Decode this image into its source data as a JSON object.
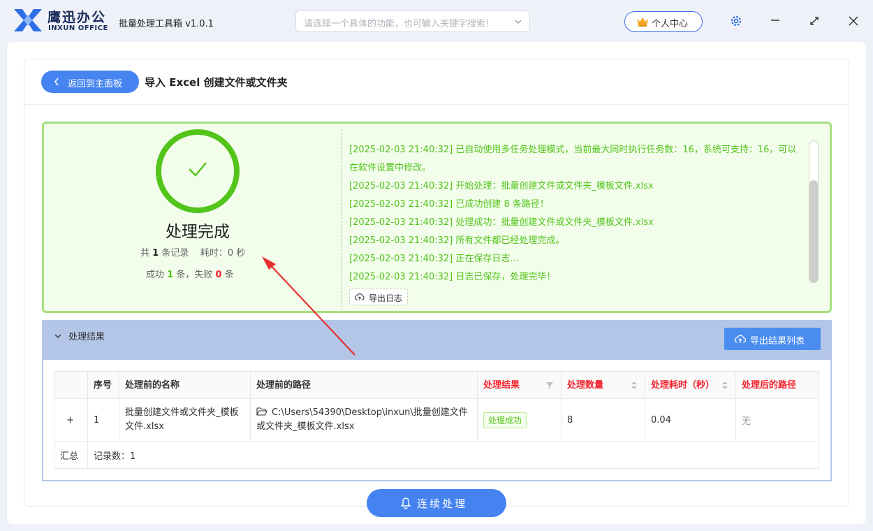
{
  "titlebar": {
    "brand_cn": "鹰迅办公",
    "brand_en": "INXUN OFFICE",
    "app_title": "批量处理工具箱 v1.0.1",
    "search_placeholder": "请选择一个具体的功能，也可输入关键字搜索！",
    "user_center": "个人中心"
  },
  "header": {
    "back_label": "返回到主面板",
    "page_title": "导入 Excel 创建文件或文件夹"
  },
  "summary": {
    "status_title": "处理完成",
    "total_prefix": "共",
    "total_count": "1",
    "total_suffix": "条记录",
    "time_label": "耗时：0 秒",
    "success_prefix": "成功",
    "success_count": "1",
    "fail_prefix": "条，失败",
    "fail_count": "0",
    "fail_suffix": "条"
  },
  "log": {
    "lines": [
      "[2025-02-03 21:40:32] 已自动使用多任务处理模式，当前最大同时执行任务数：16，系统可支持：16，可以在软件设置中修改。",
      "[2025-02-03 21:40:32] 开始处理：批量创建文件或文件夹_模板文件.xlsx",
      "[2025-02-03 21:40:32] 已成功创建 8 条路径！",
      "[2025-02-03 21:40:32] 处理成功：批量创建文件或文件夹_模板文件.xlsx",
      "[2025-02-03 21:40:32] 所有文件都已经处理完成。",
      "[2025-02-03 21:40:32] 正在保存日志...",
      "[2025-02-03 21:40:32] 日志已保存，处理完毕！"
    ],
    "export_label": "导出日志"
  },
  "results": {
    "section_title": "处理结果",
    "export_label": "导出结果列表",
    "columns": [
      "",
      "序号",
      "处理前的名称",
      "处理前的路径",
      "处理结果",
      "处理数量",
      "处理耗时（秒）",
      "处理后的路径"
    ],
    "row": {
      "expand": "+",
      "index": "1",
      "name": "批量创建文件或文件夹_模板文件.xlsx",
      "path": "C:\\Users\\54390\\Desktop\\inxun\\批量创建文件或文件夹_模板文件.xlsx",
      "status": "处理成功",
      "count": "8",
      "time": "0.04",
      "new_path": "无"
    },
    "footer_label": "汇总",
    "footer_value": "记录数：1"
  },
  "continue_label": "连续处理",
  "colors": {
    "accent": "#4583f0",
    "success": "#52c41a",
    "danger": "#f5222d",
    "panel_border": "#a6e07f"
  }
}
